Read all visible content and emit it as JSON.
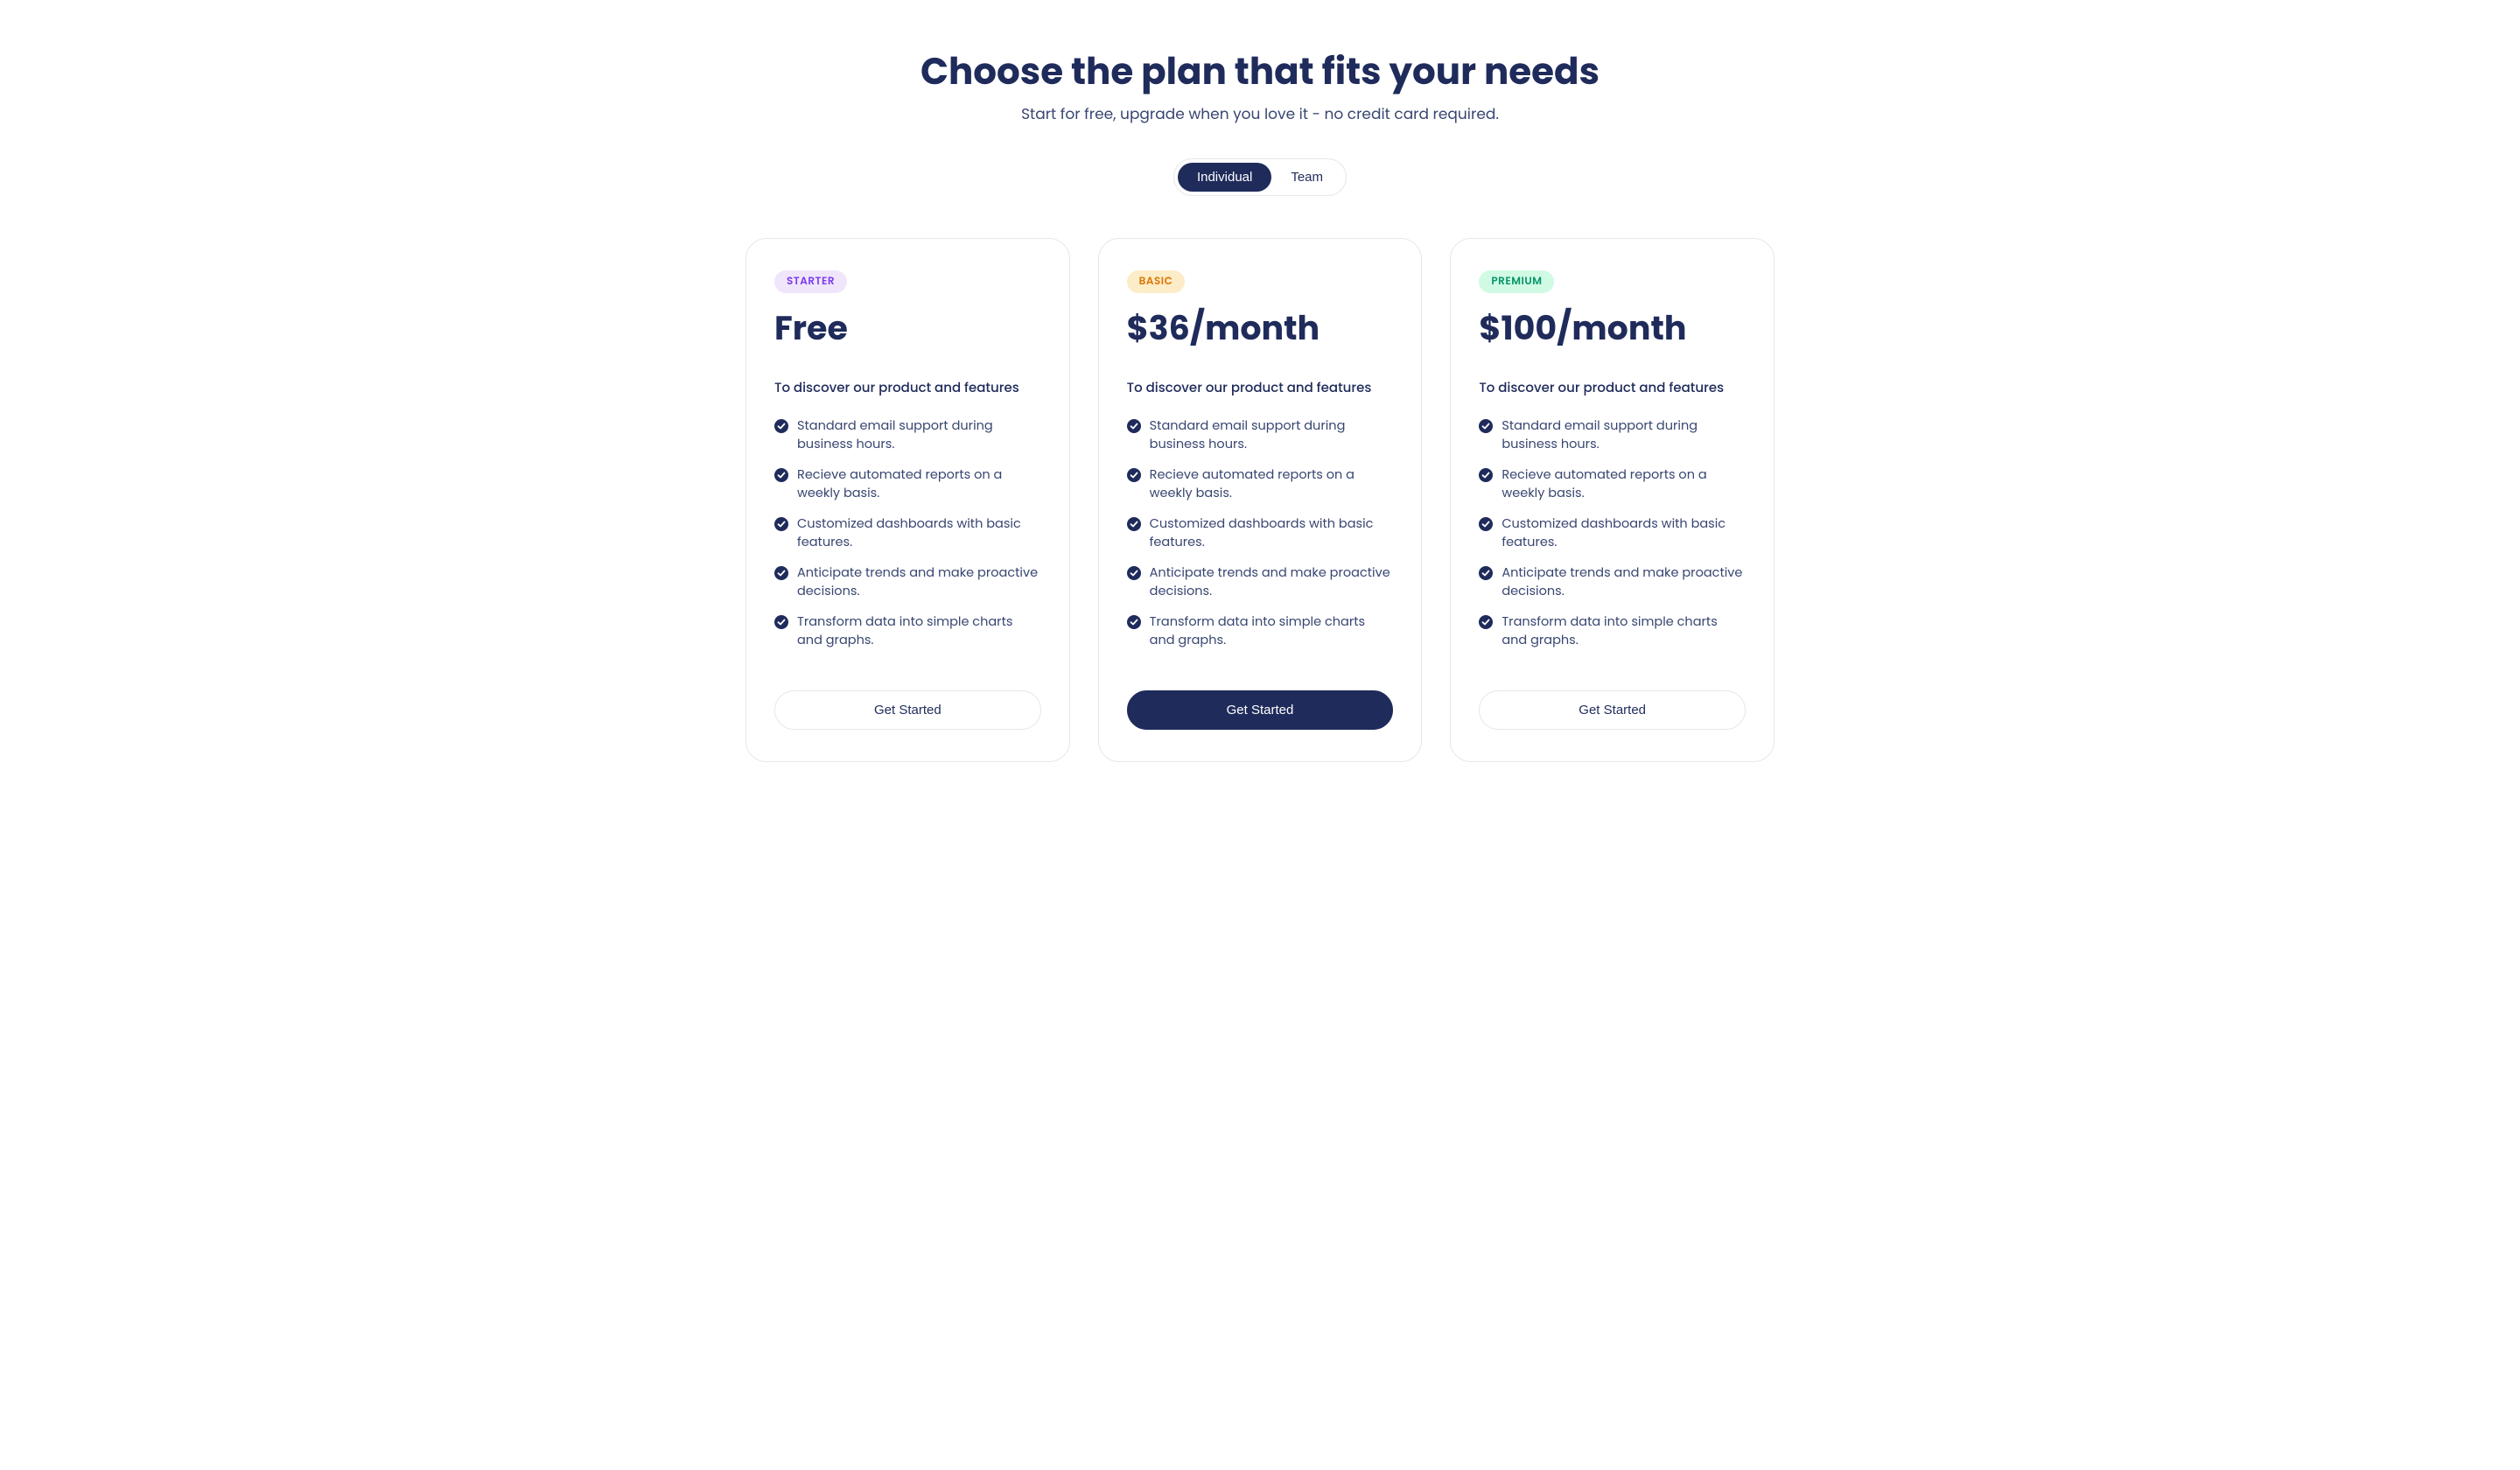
{
  "header": {
    "title": "Choose the plan that fits your needs",
    "subtitle": "Start for free, upgrade when you love it - no credit card required."
  },
  "toggle": {
    "individual": "Individual",
    "team": "Team"
  },
  "plans": [
    {
      "badge": "STARTER",
      "badge_class": "badge-starter",
      "price": "Free",
      "description": "To discover our product and features",
      "features": [
        "Standard email support during business hours.",
        "Recieve automated reports on a weekly basis.",
        "Customized dashboards with basic features.",
        "Anticipate trends and make proactive decisions.",
        "Transform data into simple charts and graphs."
      ],
      "cta": "Get Started",
      "cta_primary": false
    },
    {
      "badge": "BASIC",
      "badge_class": "badge-basic",
      "price": "$36/month",
      "description": "To discover our product and features",
      "features": [
        "Standard email support during business hours.",
        "Recieve automated reports on a weekly basis.",
        "Customized dashboards with basic features.",
        "Anticipate trends and make proactive decisions.",
        "Transform data into simple charts and graphs."
      ],
      "cta": "Get Started",
      "cta_primary": true
    },
    {
      "badge": "PREMIUM",
      "badge_class": "badge-premium",
      "price": "$100/month",
      "description": "To discover our product and features",
      "features": [
        "Standard email support during business hours.",
        "Recieve automated reports on a weekly basis.",
        "Customized dashboards with basic features.",
        "Anticipate trends and make proactive decisions.",
        "Transform data into simple charts and graphs."
      ],
      "cta": "Get Started",
      "cta_primary": false
    }
  ]
}
